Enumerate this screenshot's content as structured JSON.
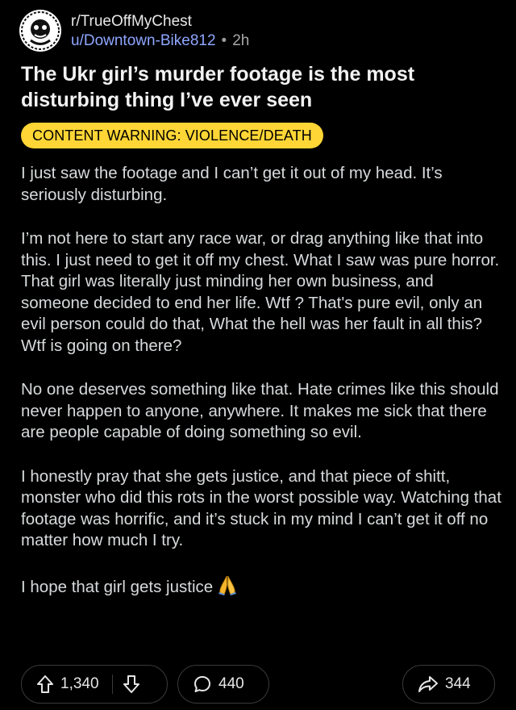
{
  "post": {
    "subreddit": "r/TrueOffMyChest",
    "username": "u/Downtown-Bike812",
    "separator": "•",
    "time": "2h",
    "title": "The Ukr girl’s murder footage is the most disturbing thing I’ve ever seen",
    "flair": "CONTENT WARNING: VIOLENCE/DEATH",
    "paragraphs": [
      "I just saw the footage and I can’t get it out of my head. It’s seriously disturbing.",
      "I’m not here to start any race war, or drag anything like that into this. I just need to get it off my chest. What I saw was pure horror. That girl was literally just minding her own business, and someone decided to end her life. Wtf ? That's pure evil, only an evil person could do that, What the hell was her fault in all this? Wtf is going on there?",
      "No one deserves something like that. Hate crimes like this should never happen to anyone, anywhere. It makes me sick that there are people capable of doing something so evil.",
      "I honestly pray that she gets justice, and that piece of shitt, monster who did this rots in the worst possible way. Watching that footage was horrific, and it’s stuck in my mind I can’t get it off no matter how much I try.",
      "I hope that girl gets justice"
    ]
  },
  "actions": {
    "upvotes": "1,340",
    "comments": "440",
    "shares": "344"
  },
  "colors": {
    "background": "#000000",
    "username": "#8fa6ff",
    "flair_bg": "#ffd635",
    "text": "#d7dadc"
  },
  "icons": {
    "avatar": "subreddit-avatar",
    "upvote": "upvote-arrow-icon",
    "downvote": "downvote-arrow-icon",
    "comment": "comment-bubble-icon",
    "share": "share-arrow-icon",
    "emoji": "folded-hands-emoji"
  }
}
